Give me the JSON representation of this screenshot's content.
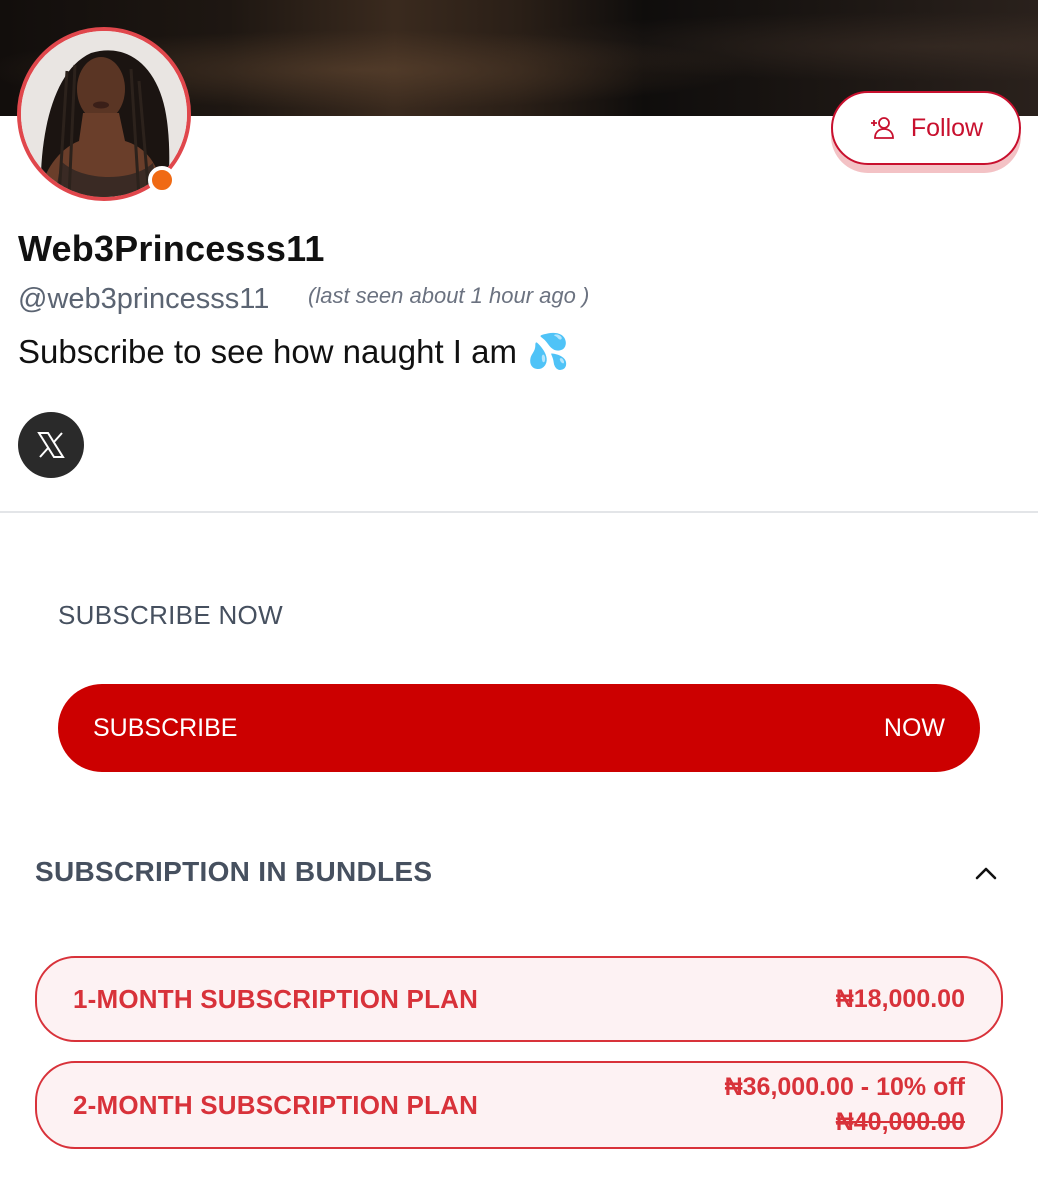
{
  "profile": {
    "display_name": "Web3Princesss11",
    "handle": "@web3princesss11",
    "last_seen": "(last seen about 1 hour ago )",
    "bio": "Subscribe to see how naught I am",
    "bio_emoji": "💦",
    "online_status_color": "#f06a14"
  },
  "follow_button": {
    "label": "Follow",
    "icon": "add-user-icon"
  },
  "social": {
    "icon": "x-logo-icon"
  },
  "subscribe_section": {
    "title": "SUBSCRIBE NOW",
    "button_left": "SUBSCRIBE",
    "button_right": "NOW"
  },
  "bundles": {
    "title": "SUBSCRIPTION IN BUNDLES",
    "expanded": true,
    "plans": [
      {
        "name": "1-MONTH SUBSCRIPTION PLAN",
        "price": "₦18,000.00"
      },
      {
        "name": "2-MONTH SUBSCRIPTION PLAN",
        "price": "₦36,000.00 - 10% off",
        "old_price": "₦40,000.00"
      }
    ]
  },
  "colors": {
    "accent": "#cc0000",
    "plan_text": "#d8323a",
    "avatar_ring": "#e0474c"
  }
}
